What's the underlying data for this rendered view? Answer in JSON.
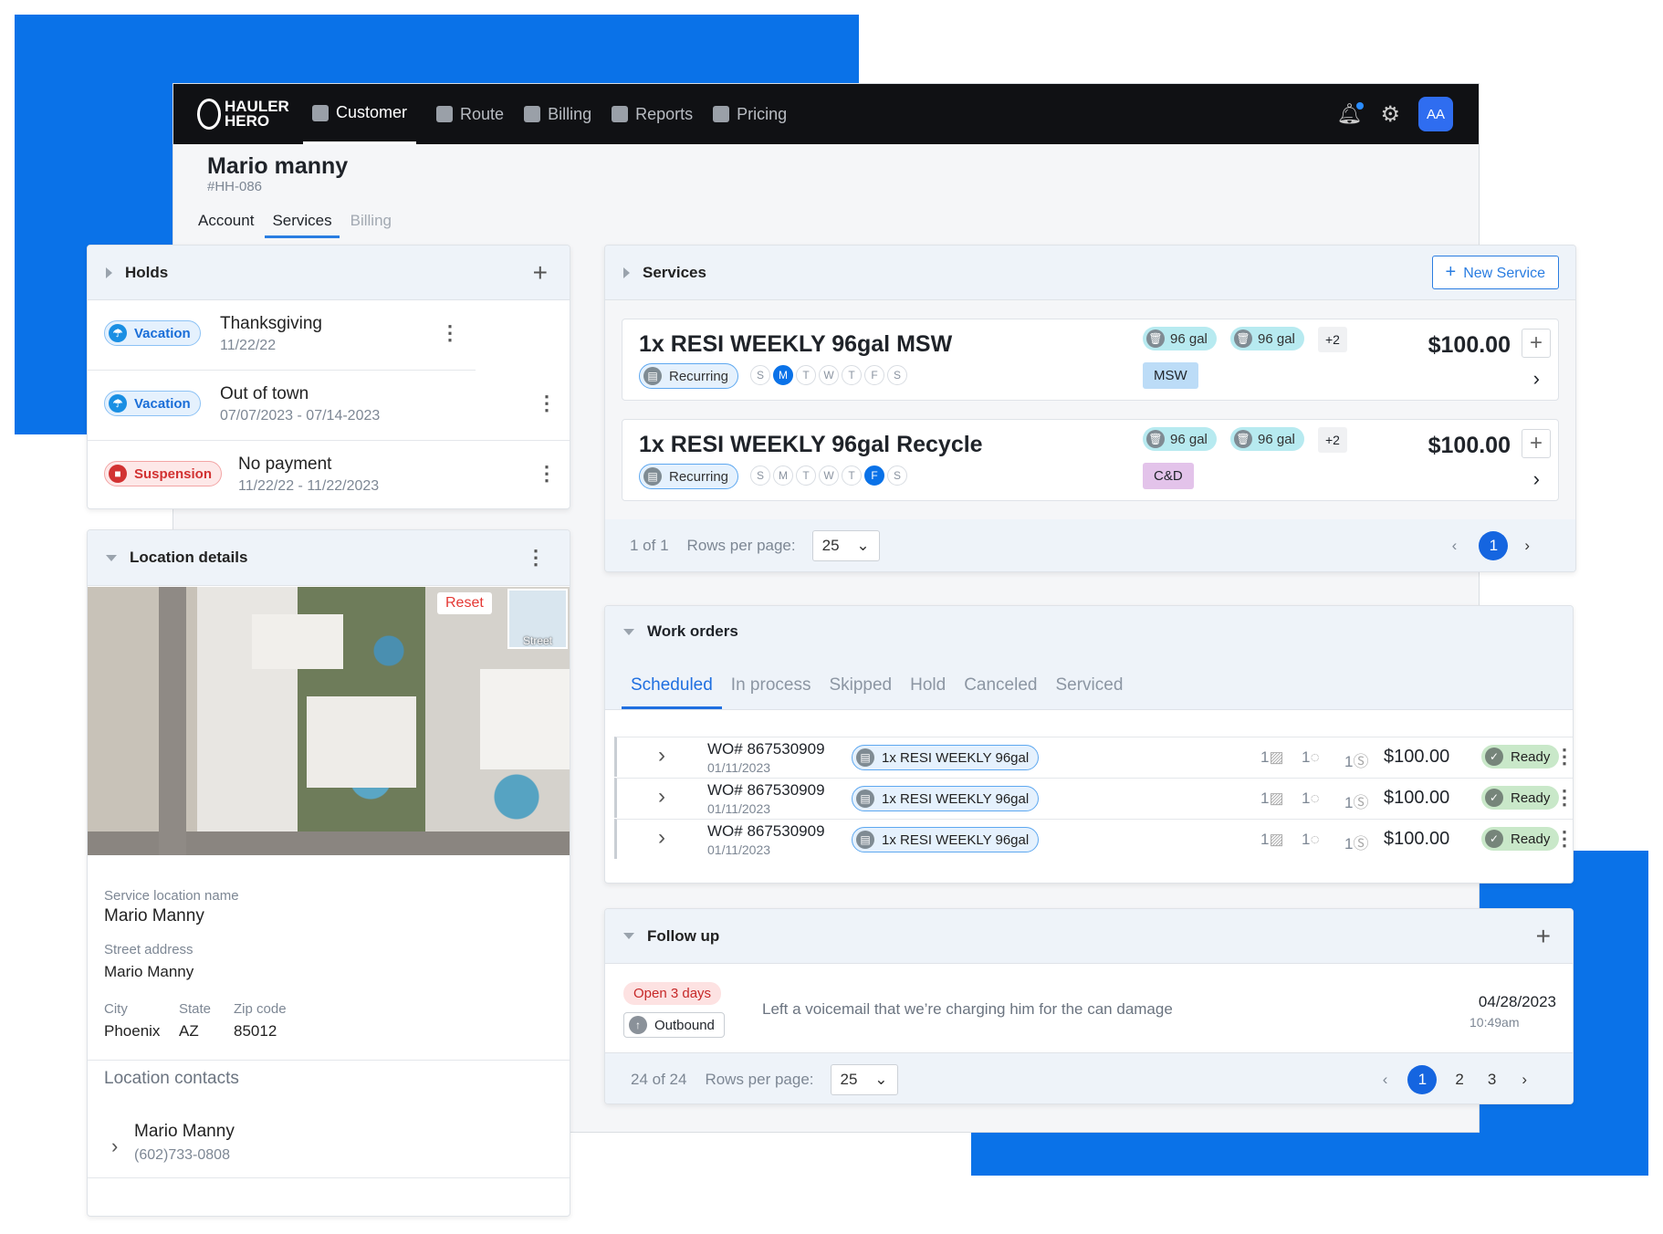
{
  "nav": {
    "logo": "HAULER HERO",
    "items": [
      {
        "label": "Customer",
        "icon": "users-icon",
        "active": true
      },
      {
        "label": "Route",
        "icon": "checkbox-icon"
      },
      {
        "label": "Billing",
        "icon": "receipt-icon"
      },
      {
        "label": "Reports",
        "icon": "chart-icon"
      },
      {
        "label": "Pricing",
        "icon": "price-doc-icon"
      }
    ],
    "avatar": "AA"
  },
  "customer": {
    "name": "Mario manny",
    "id": "#HH-086",
    "tabs": [
      "Account",
      "Services",
      "Billing"
    ],
    "active_tab": "Services"
  },
  "holds": {
    "title": "Holds",
    "items": [
      {
        "badge": "Vacation",
        "title": "Thanksgiving",
        "date": "11/22/22"
      },
      {
        "badge": "Vacation",
        "title": "Out of town",
        "date": "07/07/2023 - 07/14-2023"
      },
      {
        "badge": "Suspension",
        "title": "No payment",
        "date": "11/22/22  - 11/22/2023"
      }
    ]
  },
  "location": {
    "title": "Location details",
    "map_reset": "Reset",
    "map_street": "Street",
    "name_label": "Service location name",
    "name": "Mario Manny",
    "street_label": "Street address",
    "street": "Mario Manny",
    "city_label": "City",
    "city": "Phoenix",
    "state_label": "State",
    "state": "AZ",
    "zip_label": "Zip code",
    "zip": "85012",
    "contacts_title": "Location contacts",
    "contact_name": "Mario Manny",
    "contact_phone": "(602)733-0808"
  },
  "services": {
    "title": "Services",
    "new_button": "New Service",
    "items": [
      {
        "title": "1x RESI WEEKLY 96gal MSW",
        "recurring": "Recurring",
        "days": [
          "S",
          "M",
          "T",
          "W",
          "T",
          "F",
          "S"
        ],
        "active_day": 1,
        "gal1": "96 gal",
        "gal2": "96 gal",
        "more": "+2",
        "tag": "MSW",
        "tag_color": "#bcdcf7",
        "price": "$100.00"
      },
      {
        "title": "1x RESI WEEKLY 96gal Recycle",
        "recurring": "Recurring",
        "days": [
          "S",
          "M",
          "T",
          "W",
          "T",
          "F",
          "S"
        ],
        "active_day": 5,
        "gal1": "96 gal",
        "gal2": "96 gal",
        "more": "+2",
        "tag": "C&D",
        "tag_color": "#e3c3ea",
        "price": "$100.00"
      }
    ],
    "pagination": {
      "count": "1 of 1",
      "rows_label": "Rows per page:",
      "rows": "25",
      "page": "1"
    }
  },
  "work_orders": {
    "title": "Work orders",
    "tabs": [
      "Scheduled",
      "In process",
      "Skipped",
      "Hold",
      "Canceled",
      "Serviced"
    ],
    "active_tab": "Scheduled",
    "rows": [
      {
        "wo": "WO# 867530909",
        "date": "01/11/2023",
        "service": "1x RESI WEEKLY 96gal",
        "photos": "1",
        "comments": "1",
        "payments": "1",
        "price": "$100.00",
        "status": "Ready"
      },
      {
        "wo": "WO# 867530909",
        "date": "01/11/2023",
        "service": "1x RESI WEEKLY 96gal",
        "photos": "1",
        "comments": "1",
        "payments": "1",
        "price": "$100.00",
        "status": "Ready"
      },
      {
        "wo": "WO# 867530909",
        "date": "01/11/2023",
        "service": "1x RESI WEEKLY 96gal",
        "photos": "1",
        "comments": "1",
        "payments": "1",
        "price": "$100.00",
        "status": "Ready"
      }
    ]
  },
  "follow_up": {
    "title": "Follow up",
    "status": "Open 3 days",
    "direction": "Outbound",
    "note": "Left a voicemail that we’re charging him for the can damage",
    "date": "04/28/2023",
    "time": "10:49am",
    "pagination": {
      "count": "24 of 24",
      "rows_label": "Rows per page:",
      "rows": "25",
      "pages": [
        "1",
        "2",
        "3"
      ]
    }
  }
}
